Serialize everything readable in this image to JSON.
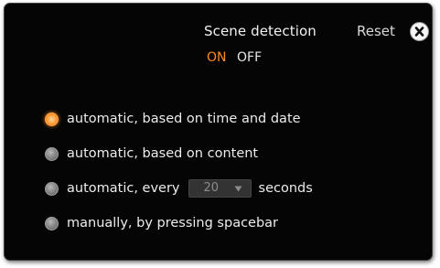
{
  "header": {
    "title": "Scene detection",
    "reset_label": "Reset",
    "toggle": {
      "on_label": "ON",
      "off_label": "OFF",
      "selected": "ON"
    }
  },
  "options": [
    {
      "label": "automatic, based on time and date",
      "selected": true
    },
    {
      "label": "automatic, based on content",
      "selected": false
    },
    {
      "label_prefix": "automatic, every",
      "interval_value": "20",
      "label_suffix": "seconds",
      "selected": false
    },
    {
      "label": "manually, by pressing spacebar",
      "selected": false
    }
  ],
  "icons": {
    "close": "close-icon",
    "dropdown": "chevron-down-icon"
  },
  "colors": {
    "panel_bg": "#050505",
    "accent": "#ff8a1e",
    "text": "#ececec",
    "muted": "#8c8c8c"
  }
}
